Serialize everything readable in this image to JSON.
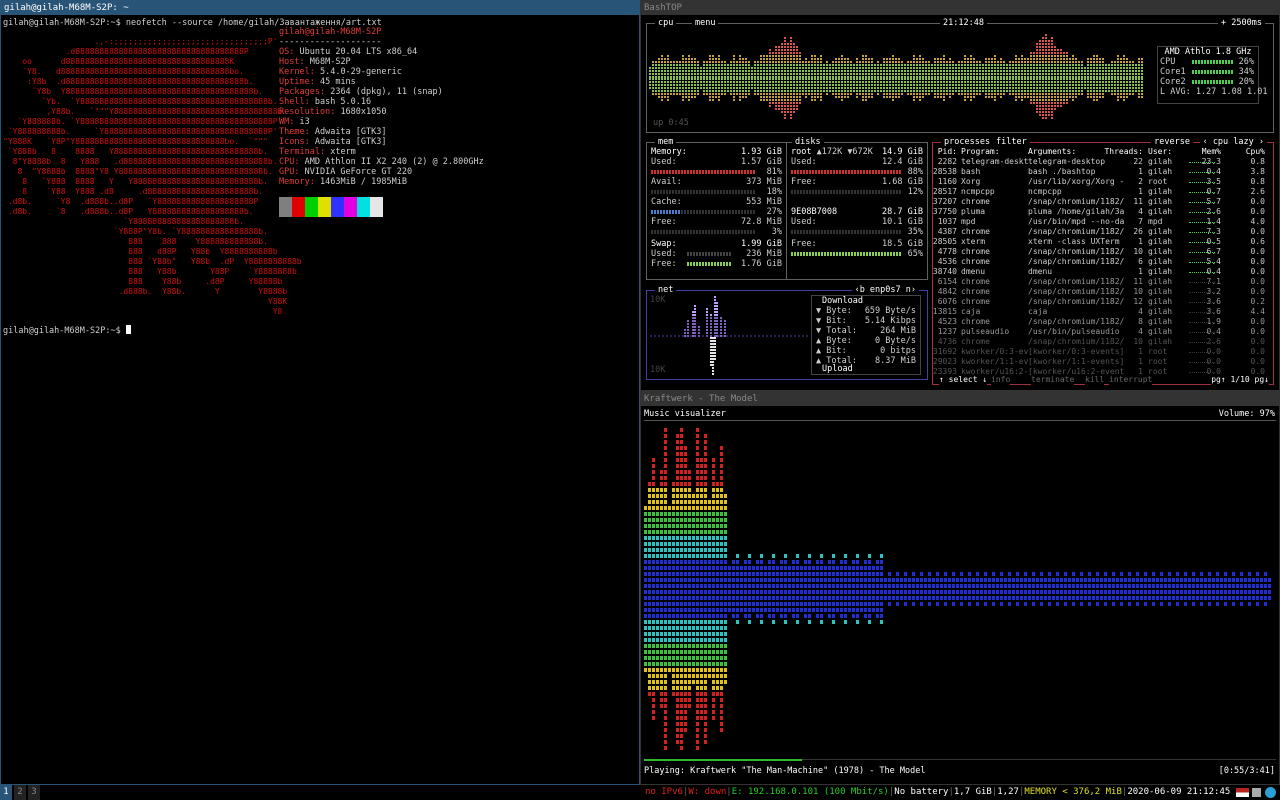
{
  "terminal": {
    "title": "gilah@gilah-M68M-S2P: ~",
    "prompt": "gilah@gilah-M68M-S2P:~$",
    "command": "neofetch --source /home/gilah/Завантаження/art.txt",
    "user_host": "gilah@gilah-M68M-S2P",
    "separator": "--------------------",
    "info": [
      {
        "k": "OS",
        "v": "Ubuntu 20.04 LTS x86_64"
      },
      {
        "k": "Host",
        "v": "M68M-S2P"
      },
      {
        "k": "Kernel",
        "v": "5.4.0-29-generic"
      },
      {
        "k": "Uptime",
        "v": "45 mins"
      },
      {
        "k": "Packages",
        "v": "2364 (dpkg), 11 (snap)"
      },
      {
        "k": "Shell",
        "v": "bash 5.0.16"
      },
      {
        "k": "Resolution",
        "v": "1680x1050"
      },
      {
        "k": "WM",
        "v": "i3"
      },
      {
        "k": "Theme",
        "v": "Adwaita [GTK3]"
      },
      {
        "k": "Icons",
        "v": "Adwaita [GTK3]"
      },
      {
        "k": "Terminal",
        "v": "xterm"
      },
      {
        "k": "CPU",
        "v": "AMD Athlon II X2 240 (2) @ 2.800GHz"
      },
      {
        "k": "GPU",
        "v": "NVIDIA GeForce GT 220"
      },
      {
        "k": "Memory",
        "v": "1463MiB / 1985MiB"
      }
    ],
    "swatches": [
      "#7f7f7f",
      "#e00000",
      "#00d000",
      "#e0e000",
      "#3030ff",
      "#e000e0",
      "#00e0e0",
      "#e6e6e6"
    ],
    "prompt2": "gilah@gilah-M68M-S2P:~$"
  },
  "bashtop": {
    "title": "BashTOP",
    "cpu_label": "cpu",
    "menu_label": "menu",
    "clock": "21:12:48",
    "interval": "2500ms",
    "uptime": "up 0:45",
    "cpu_name": "AMD Athlo  1.8 GHz",
    "cpu_rows": [
      {
        "name": "CPU",
        "pct": "26%"
      },
      {
        "name": "Core1",
        "pct": "34%"
      },
      {
        "name": "Core2",
        "pct": "20%"
      }
    ],
    "load_avg": "L AVG: 1.27 1.08 1.01",
    "mem": {
      "label": "mem",
      "memory": "1.93 GiB",
      "used": "1.57 GiB",
      "used_pct": "81%",
      "avail": "373 MiB",
      "avail_pct": "18%",
      "cache": "553 MiB",
      "cache_pct": "27%",
      "free": "72.8 MiB",
      "free_pct": "3%",
      "swap": "1.99 GiB",
      "swap_used": "236 MiB",
      "swap_free": "1.76 GiB"
    },
    "disks": {
      "label": "disks",
      "root": "root",
      "root_io": "▲172K ▼672K",
      "root_size": "14.9 GiB",
      "root_used": "12.4 GiB",
      "root_used_pct": "88%",
      "root_free": "1.68 GiB",
      "root_free_pct": "12%",
      "dev": "9E08B7008",
      "dev_size": "28.7 GiB",
      "dev_used": "10.1 GiB",
      "dev_used_pct": "35%",
      "dev_free": "18.5 GiB",
      "dev_free_pct": "65%"
    },
    "net": {
      "label": "net",
      "iface": "‹b enp0s7 n›",
      "top_scale": "10K",
      "bottom_scale": "10K",
      "download_label": "Download",
      "dl_byte": "659 Byte/s",
      "dl_bit": "5.14 Kibps",
      "dl_total": "264 MiB",
      "ul_byte": "0 Byte/s",
      "ul_bit": "0 bitps",
      "ul_total": "8.37 MiB",
      "upload_label": "Upload"
    },
    "proc": {
      "label": "processes",
      "filter": "filter",
      "reverse": "reverse",
      "sort": "‹ cpu lazy ›",
      "headers": [
        "Pid:",
        "Program:",
        "Arguments:",
        "Threads:",
        "User:",
        "Mem%",
        "Cpu%"
      ],
      "rows": [
        [
          "2282",
          "telegram-deskt",
          "telegram-desktop",
          "22",
          "gilah",
          "23.3",
          "0.8"
        ],
        [
          "28538",
          "bash",
          "bash ./bashtop",
          "1",
          "gilah",
          "0.4",
          "3.8"
        ],
        [
          "1160",
          "Xorg",
          "/usr/lib/xorg/Xorg -",
          "2",
          "root",
          "3.5",
          "0.8"
        ],
        [
          "28517",
          "ncmpcpp",
          "ncmpcpp",
          "1",
          "gilah",
          "0.7",
          "2.6"
        ],
        [
          "37207",
          "chrome",
          "/snap/chromium/1182/",
          "11",
          "gilah",
          "5.7",
          "0.0"
        ],
        [
          "37750",
          "pluma",
          "pluma /home/gilah/3a",
          "4",
          "gilah",
          "2.6",
          "0.0"
        ],
        [
          "1037",
          "mpd",
          "/usr/bin/mpd --no-da",
          "7",
          "mpd",
          "1.4",
          "4.0"
        ],
        [
          "4387",
          "chrome",
          "/snap/chromium/1182/",
          "26",
          "gilah",
          "7.3",
          "0.0"
        ],
        [
          "28505",
          "xterm",
          "xterm -class UXTerm",
          "1",
          "gilah",
          "0.5",
          "0.6"
        ],
        [
          "4778",
          "chrome",
          "/snap/chromium/1182/",
          "10",
          "gilah",
          "6.7",
          "0.0"
        ],
        [
          "4536",
          "chrome",
          "/snap/chromium/1182/",
          "6",
          "gilah",
          "5.4",
          "0.0"
        ],
        [
          "38740",
          "dmenu",
          "dmenu",
          "1",
          "gilah",
          "0.4",
          "0.0"
        ],
        [
          "6154",
          "chrome",
          "/snap/chromium/1182/",
          "11",
          "gilah",
          "7.1",
          "0.0"
        ],
        [
          "4842",
          "chrome",
          "/snap/chromium/1182/",
          "10",
          "gilah",
          "3.2",
          "0.0"
        ],
        [
          "6076",
          "chrome",
          "/snap/chromium/1182/",
          "12",
          "gilah",
          "3.6",
          "0.2"
        ],
        [
          "13815",
          "caja",
          "caja",
          "4",
          "gilah",
          "3.6",
          "4.4"
        ],
        [
          "4523",
          "chrome",
          "/snap/chromium/1182/",
          "8",
          "gilah",
          "1.9",
          "0.0"
        ],
        [
          "1237",
          "pulseaudio",
          "/usr/bin/pulseaudio",
          "4",
          "gilah",
          "0.4",
          "0.0"
        ],
        [
          "4736",
          "chrome",
          "/snap/chromium/1182/",
          "10",
          "gilah",
          "2.6",
          "0.0"
        ],
        [
          "31692",
          "kworker/0:3-ev",
          "[kworker/0:3-events]",
          "1",
          "root",
          "0.0",
          "0.0"
        ],
        [
          "29023",
          "kworker/1:1-ev",
          "[kworker/1:1-events]",
          "1",
          "root",
          "0.0",
          "0.0"
        ],
        [
          "23393",
          "kworker/u16:2-",
          "[kworker/u16:2-event",
          "1",
          "root",
          "0.0",
          "0.0"
        ]
      ],
      "footer_select": "select",
      "footer_info": "info",
      "footer_terminate": "terminate",
      "footer_kill": "kill",
      "footer_interrupt": "interrupt",
      "footer_page": "pg↑ 1/10 pg↓"
    }
  },
  "music": {
    "title": "Kraftwerk - The Model",
    "header": "Music visualizer",
    "volume": "Volume: 97%",
    "playing_label": "Playing:",
    "playing": "Kraftwerk \"The Man-Machine\" (1978) - The Model",
    "time": "[0:55/3:41]",
    "progress": 0.25
  },
  "statusbar": {
    "workspaces": [
      "1",
      "2",
      "3"
    ],
    "ipv6": "no IPv6",
    "wifi": "W: down",
    "eth": "E: 192.168.0.101 (100 Mbit/s)",
    "battery": "No battery",
    "disk": "1,7 GiB",
    "load": "1,27",
    "memory": "MEMORY < 376,2 MiB",
    "datetime": "2020-06-09 21:12:45"
  }
}
